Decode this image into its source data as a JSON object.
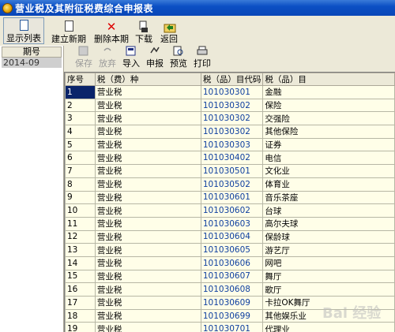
{
  "window": {
    "title": "营业税及其附征税费综合申报表"
  },
  "toolbar": {
    "show_list": "显示列表",
    "new_period": "建立新期",
    "delete_period": "删除本期",
    "download": "下载",
    "back": "返回"
  },
  "period_panel": {
    "header": "期号",
    "items": [
      "2014-09"
    ]
  },
  "actions": {
    "save": "保存",
    "discard": "放弃",
    "import": "导入",
    "declare": "申报",
    "preview": "预览",
    "print": "打印"
  },
  "table": {
    "headers": [
      "序号",
      "税（费）种",
      "税（品）目代码",
      "税（品）目"
    ],
    "rows": [
      [
        "1",
        "营业税",
        "101030301",
        "金融"
      ],
      [
        "2",
        "营业税",
        "101030302",
        "保险"
      ],
      [
        "3",
        "营业税",
        "101030302",
        "交强险"
      ],
      [
        "4",
        "营业税",
        "101030302",
        "其他保险"
      ],
      [
        "5",
        "营业税",
        "101030303",
        "证券"
      ],
      [
        "6",
        "营业税",
        "101030402",
        "电信"
      ],
      [
        "7",
        "营业税",
        "101030501",
        "文化业"
      ],
      [
        "8",
        "营业税",
        "101030502",
        "体育业"
      ],
      [
        "9",
        "营业税",
        "101030601",
        "音乐茶座"
      ],
      [
        "10",
        "营业税",
        "101030602",
        "台球"
      ],
      [
        "11",
        "营业税",
        "101030603",
        "高尔夫球"
      ],
      [
        "12",
        "营业税",
        "101030604",
        "保龄球"
      ],
      [
        "13",
        "营业税",
        "101030605",
        "游艺厅"
      ],
      [
        "14",
        "营业税",
        "101030606",
        "网吧"
      ],
      [
        "15",
        "营业税",
        "101030607",
        "舞厅"
      ],
      [
        "16",
        "营业税",
        "101030608",
        "歌厅"
      ],
      [
        "17",
        "营业税",
        "101030609",
        "卡拉OK舞厅"
      ],
      [
        "18",
        "营业税",
        "101030699",
        "其他娱乐业"
      ],
      [
        "19",
        "营业税",
        "101030701",
        "代理业"
      ]
    ]
  },
  "watermark": "Bai 经验"
}
